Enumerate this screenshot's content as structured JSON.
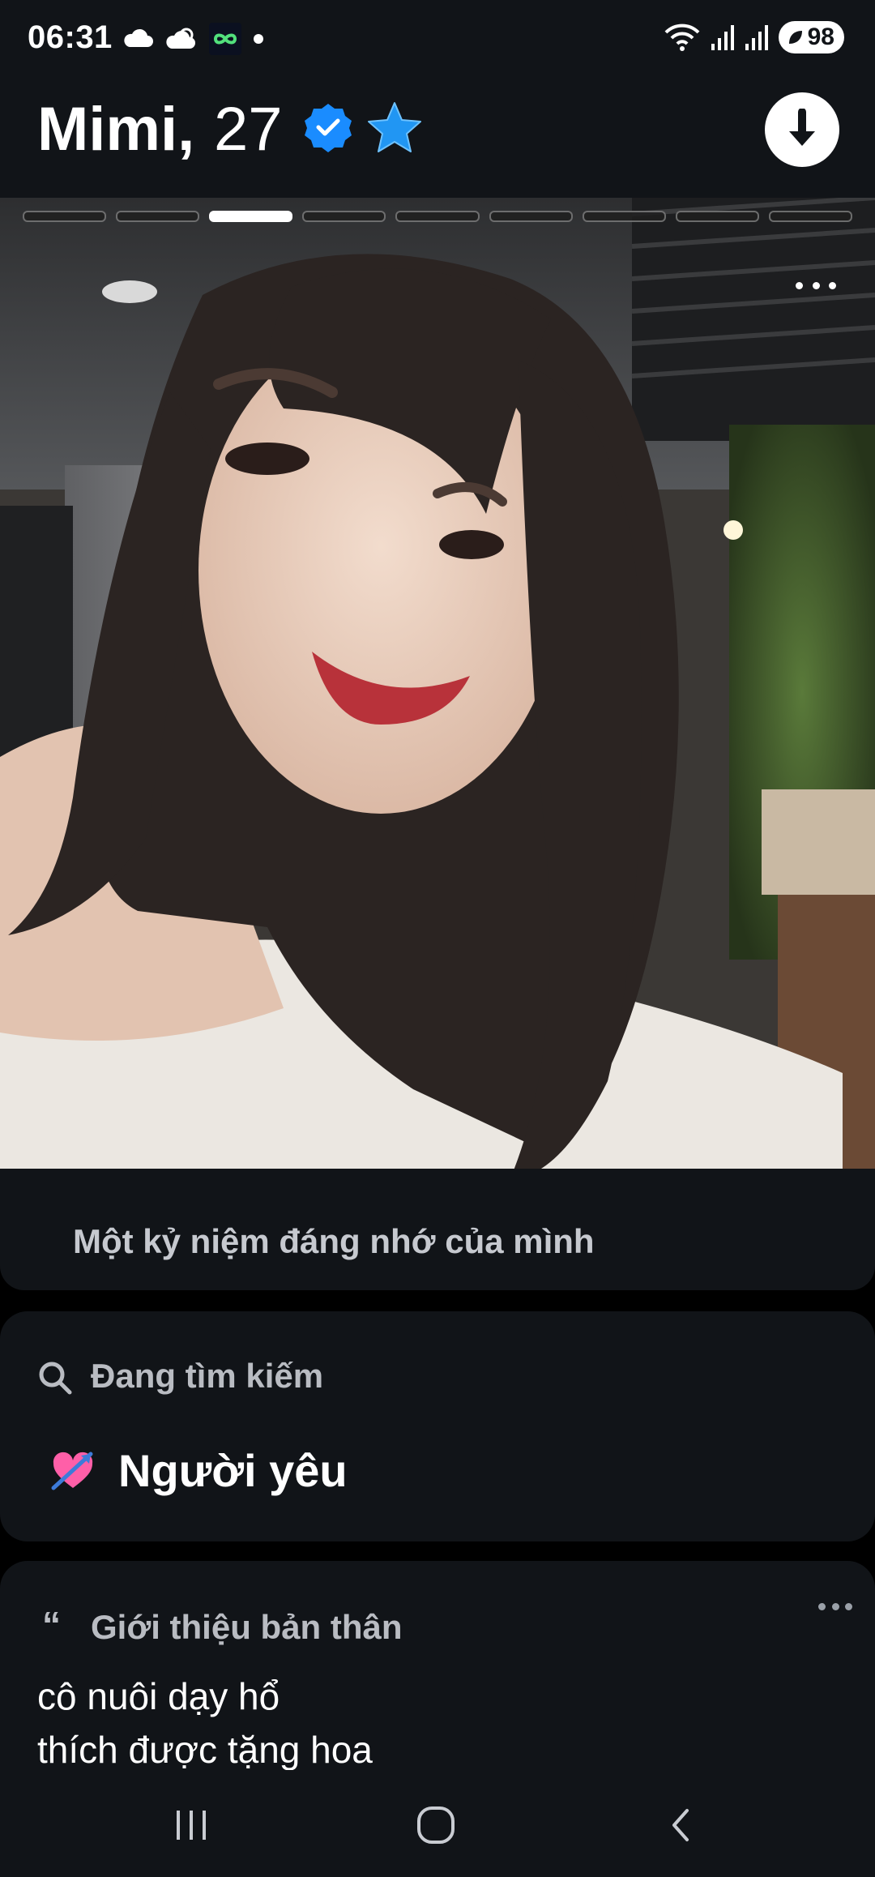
{
  "status_bar": {
    "time": "06:31",
    "battery": "98",
    "icons": [
      "cloud-icon",
      "cloud-sun-icon",
      "infinity-app-icon",
      "dot-icon",
      "wifi-icon",
      "signal-icon",
      "signal-icon",
      "battery-icon"
    ]
  },
  "profile": {
    "name": "Mimi,",
    "age": "27",
    "badges": [
      "verified-badge-icon",
      "star-icon"
    ],
    "photo_count": 9,
    "active_photo_index": 2
  },
  "photo": {
    "caption": "Một kỷ niệm đáng nhớ của mình"
  },
  "looking_for": {
    "title": "Đang tìm kiếm",
    "value": "Người yêu",
    "icon": "heart-arrow-icon"
  },
  "about": {
    "quote_mark": "“",
    "title": "Giới thiệu bản thân",
    "lines": [
      "cô nuôi dạy hổ",
      "thích được tặng hoa"
    ]
  },
  "navigation": {
    "buttons": [
      "recents-icon",
      "home-icon",
      "back-icon"
    ]
  },
  "colors": {
    "background": "#111418",
    "verified_blue": "#1a8cff",
    "star_blue": "#2196f3",
    "muted_text": "#b9bcc2"
  }
}
